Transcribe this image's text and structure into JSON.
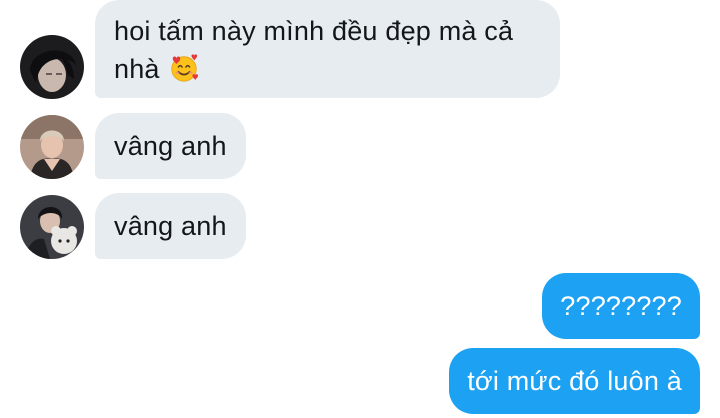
{
  "messages": [
    {
      "direction": "incoming",
      "text": "hoi tấm này mình đều đẹp mà cả nhà",
      "emoji": "smiling-face-with-hearts-icon"
    },
    {
      "direction": "incoming",
      "text": "vâng anh"
    },
    {
      "direction": "incoming",
      "text": "vâng anh"
    },
    {
      "direction": "outgoing",
      "text": "????????"
    },
    {
      "direction": "outgoing",
      "text": "tới mức đó luôn à"
    }
  ],
  "colors": {
    "incoming_bubble": "#e6ecf0",
    "outgoing_bubble": "#1da1f2",
    "incoming_text": "#14171a",
    "outgoing_text": "#ffffff"
  }
}
